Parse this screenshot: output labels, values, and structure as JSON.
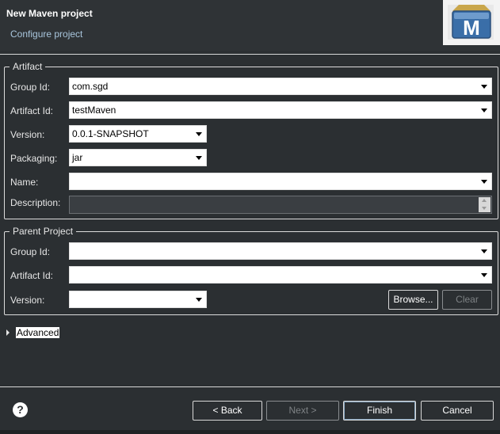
{
  "header": {
    "title": "New Maven project",
    "subtitle": "Configure project",
    "logo_letter": "M",
    "logo_icon": "maven-logo-icon"
  },
  "artifact": {
    "legend": "Artifact",
    "group_id": {
      "label": "Group Id:",
      "value": "com.sgd"
    },
    "artifact_id": {
      "label": "Artifact Id:",
      "value": "testMaven"
    },
    "version": {
      "label": "Version:",
      "value": "0.0.1-SNAPSHOT"
    },
    "packaging": {
      "label": "Packaging:",
      "value": "jar"
    },
    "name": {
      "label": "Name:",
      "value": ""
    },
    "description": {
      "label": "Description:",
      "value": ""
    }
  },
  "parent": {
    "legend": "Parent Project",
    "group_id": {
      "label": "Group Id:",
      "value": ""
    },
    "artifact_id": {
      "label": "Artifact Id:",
      "value": ""
    },
    "version": {
      "label": "Version:",
      "value": ""
    },
    "browse_label": "Browse...",
    "clear_label": "Clear"
  },
  "advanced": {
    "label": "Advanced",
    "icon": "expand-triangle-icon"
  },
  "footer": {
    "help_icon": "help-icon",
    "back_label": "< Back",
    "next_label": "Next >",
    "finish_label": "Finish",
    "cancel_label": "Cancel"
  },
  "colors": {
    "background": "#2b2f32",
    "subtitle": "#a9c6dd",
    "logo_blue": "#3a6ea8"
  }
}
